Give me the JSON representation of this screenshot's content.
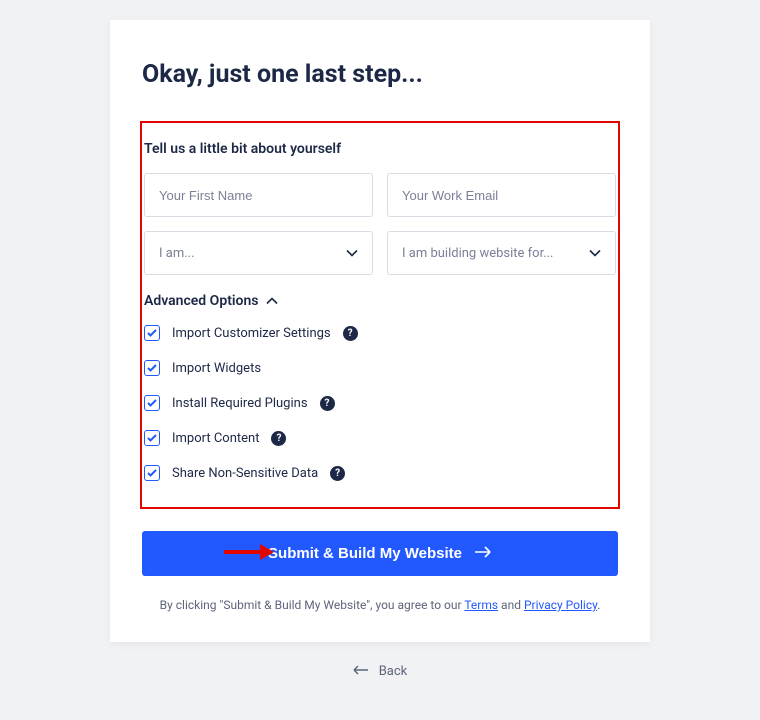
{
  "title": "Okay, just one last step...",
  "section_title": "Tell us a little bit about yourself",
  "inputs": {
    "first_name_placeholder": "Your First Name",
    "email_placeholder": "Your Work Email",
    "role_placeholder": "I am...",
    "building_for_placeholder": "I am building website for..."
  },
  "advanced": {
    "header": "Advanced Options",
    "options": [
      {
        "label": "Import Customizer Settings",
        "help": true
      },
      {
        "label": "Import Widgets",
        "help": false
      },
      {
        "label": "Install Required Plugins",
        "help": true
      },
      {
        "label": "Import Content",
        "help": true
      },
      {
        "label": "Share Non-Sensitive Data",
        "help": true
      }
    ]
  },
  "submit_label": "Submit & Build My Website",
  "agree": {
    "prefix": "By clicking \"Submit & Build My Website\", you agree to our ",
    "terms": "Terms",
    "and": " and ",
    "privacy": "Privacy Policy",
    "suffix": "."
  },
  "back_label": "Back",
  "colors": {
    "accent": "#2259ff",
    "highlight_border": "#e10600",
    "text_dark": "#1d2846"
  }
}
